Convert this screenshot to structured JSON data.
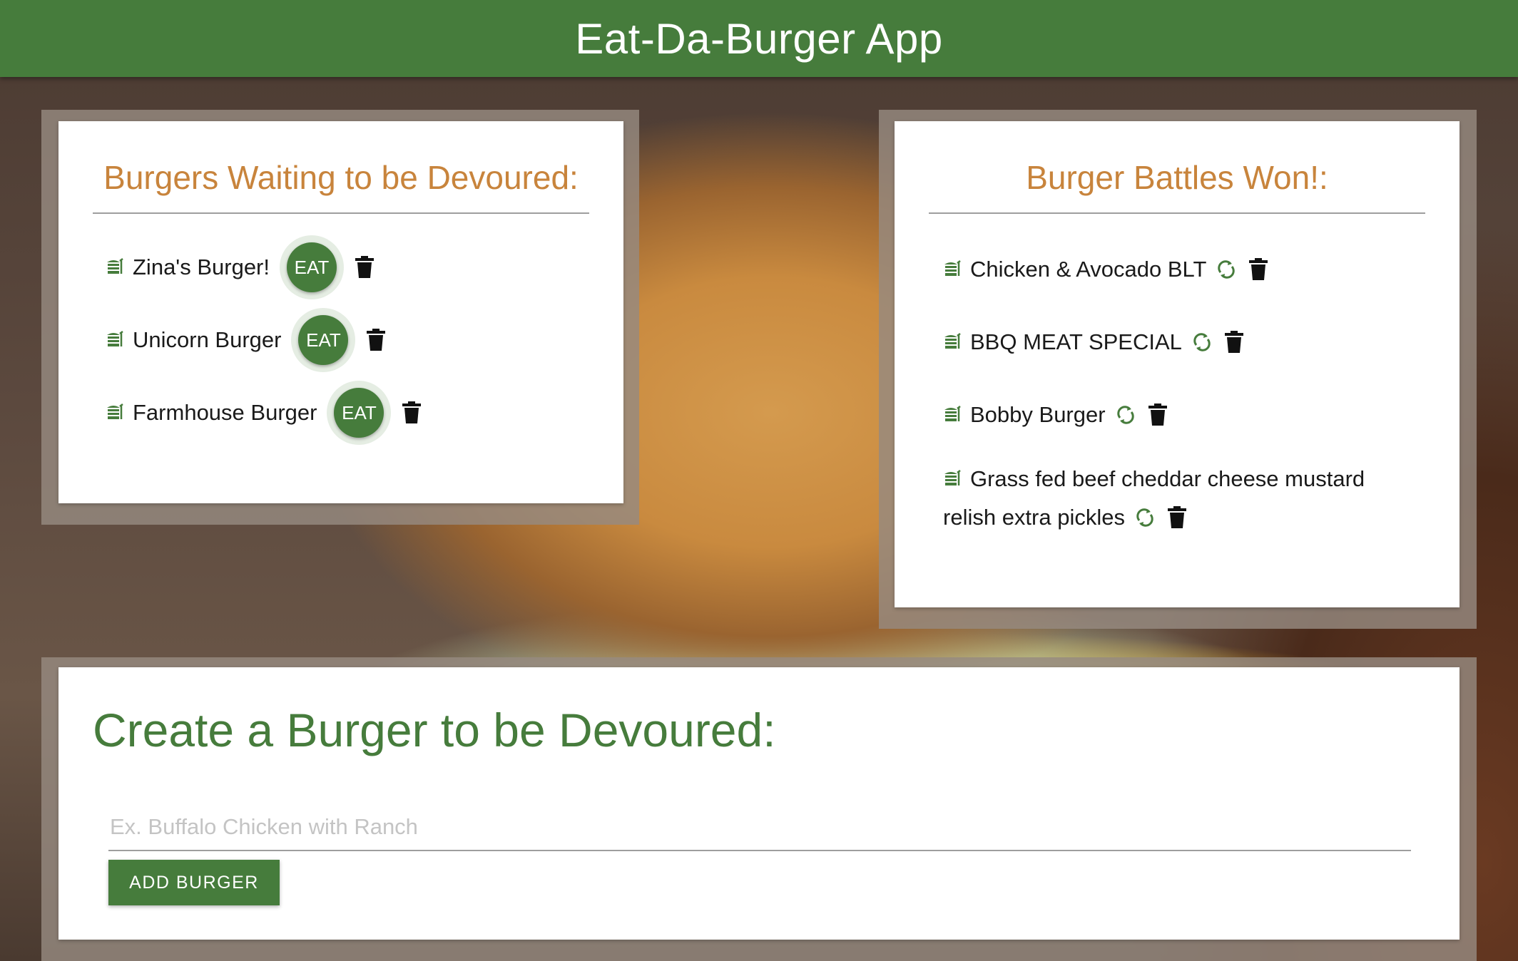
{
  "app": {
    "title": "Eat-Da-Burger App"
  },
  "waiting": {
    "title": "Burgers Waiting to be Devoured:",
    "eat_label": "EAT",
    "items": [
      {
        "name": "Zina's Burger!"
      },
      {
        "name": "Unicorn Burger"
      },
      {
        "name": "Farmhouse Burger"
      }
    ]
  },
  "won": {
    "title": "Burger Battles Won!:",
    "items": [
      {
        "name": "Chicken & Avocado BLT"
      },
      {
        "name": "BBQ MEAT SPECIAL"
      },
      {
        "name": "Bobby Burger"
      },
      {
        "name_line1": "Grass fed beef cheddar cheese mustard",
        "name_line2": "relish extra pickles"
      }
    ]
  },
  "create": {
    "title": "Create a Burger to be Devoured:",
    "input_value": "",
    "input_placeholder": "Ex. Buffalo Chicken with Ranch",
    "add_button_label": "ADD BURGER"
  },
  "colors": {
    "brand_green": "#467c3c",
    "heading_orange": "#c8843c"
  },
  "icons": {
    "burger": "hamburger-icon",
    "eat": "eat-button",
    "trash": "trash-icon",
    "redo": "redo-icon"
  }
}
